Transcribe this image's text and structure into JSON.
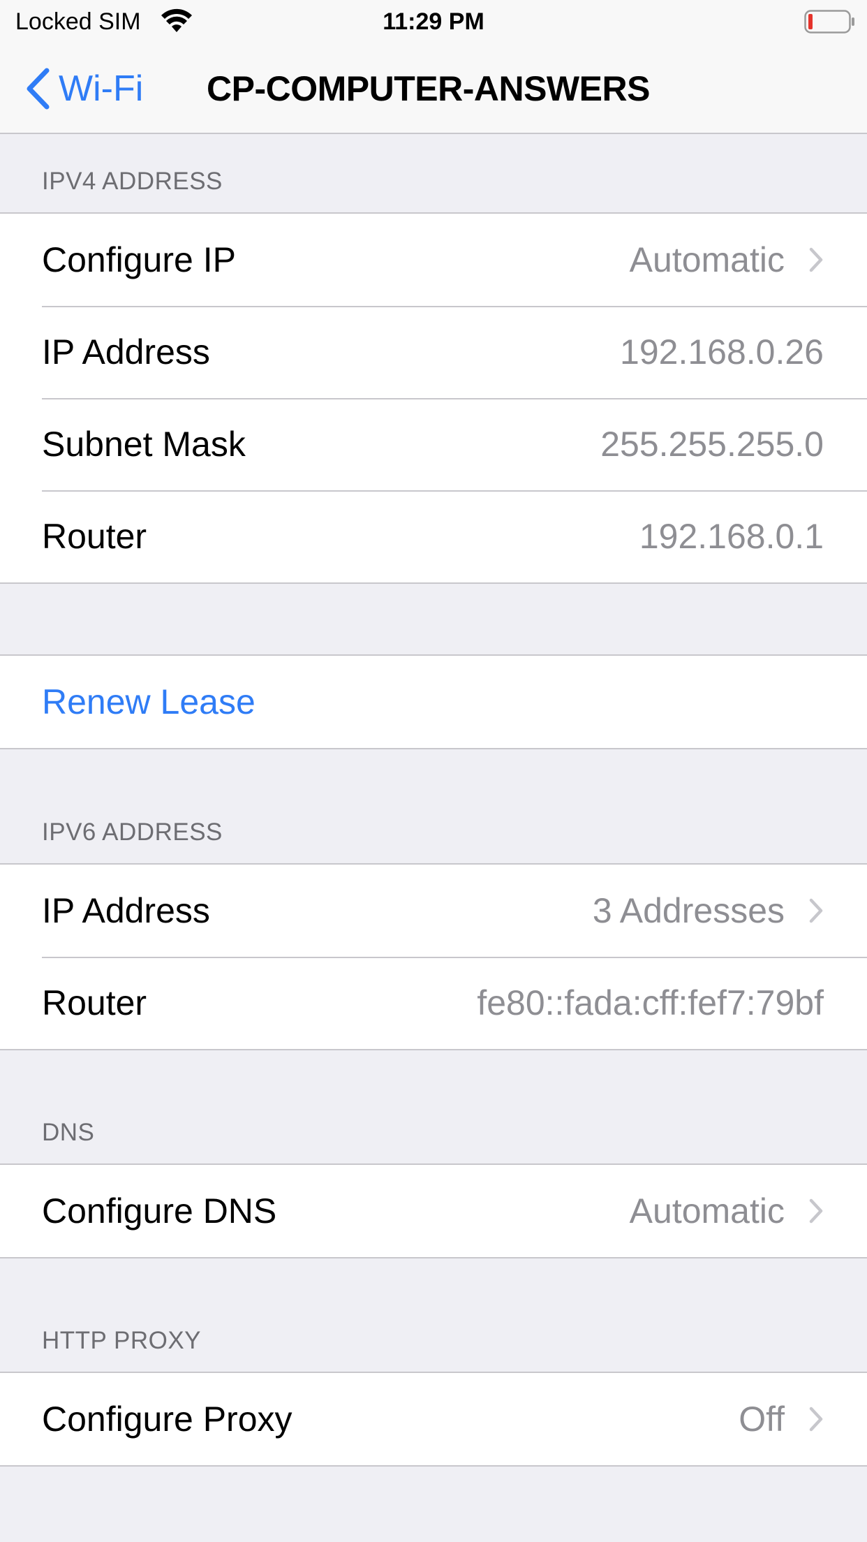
{
  "status_bar": {
    "carrier": "Locked SIM",
    "time": "11:29 PM",
    "wifi_icon": "wifi-icon",
    "battery_icon": "battery-low-icon",
    "battery_color": "#e5332b"
  },
  "nav": {
    "back_label": "Wi-Fi",
    "title": "CP-COMPUTER-ANSWERS",
    "accent_color": "#2f7cf6"
  },
  "ipv4": {
    "header": "IPV4 ADDRESS",
    "configure_ip": {
      "label": "Configure IP",
      "value": "Automatic"
    },
    "ip_address": {
      "label": "IP Address",
      "value": "192.168.0.26"
    },
    "subnet_mask": {
      "label": "Subnet Mask",
      "value": "255.255.255.0"
    },
    "router": {
      "label": "Router",
      "value": "192.168.0.1"
    }
  },
  "renew_lease": {
    "label": "Renew Lease"
  },
  "ipv6": {
    "header": "IPV6 ADDRESS",
    "ip_address": {
      "label": "IP Address",
      "value": "3 Addresses"
    },
    "router": {
      "label": "Router",
      "value": "fe80::fada:cff:fef7:79bf"
    }
  },
  "dns": {
    "header": "DNS",
    "configure_dns": {
      "label": "Configure DNS",
      "value": "Automatic"
    }
  },
  "http_proxy": {
    "header": "HTTP PROXY",
    "configure_proxy": {
      "label": "Configure Proxy",
      "value": "Off"
    }
  }
}
